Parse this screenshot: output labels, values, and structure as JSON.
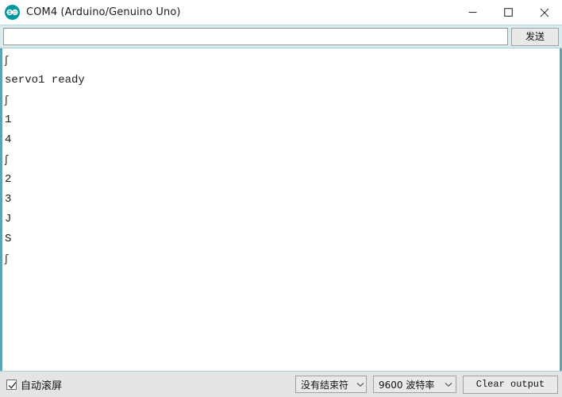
{
  "window": {
    "title": "COM4 (Arduino/Genuino Uno)",
    "logo_icon": "arduino-infinity-logo",
    "controls": [
      {
        "name": "minimize",
        "icon": "minimize-icon"
      },
      {
        "name": "maximize",
        "icon": "maximize-icon"
      },
      {
        "name": "close",
        "icon": "close-icon"
      }
    ]
  },
  "send_bar": {
    "input_value": "",
    "input_placeholder": "",
    "send_label": "发送"
  },
  "output": {
    "lines": [
      "ʃ",
      "servo1 ready",
      "ʃ",
      "1",
      "4",
      "ʃ",
      "2",
      "3",
      "J",
      "S",
      "ʃ"
    ]
  },
  "bottom_bar": {
    "autoscroll_label": "自动滚屏",
    "autoscroll_checked": true,
    "check_icon": "checkmark-icon",
    "line_ending_value": "没有结束符",
    "baud_rate_value": "9600 波特率",
    "clear_label": "Clear output",
    "dropdown_icon": "chevron-down-icon"
  },
  "colors": {
    "accent_teal": "#5aa5b5",
    "panel_teal": "#d9ecee",
    "bottom_gray": "#e4e4e4",
    "button_face": "#e9e9e9",
    "logo_teal": "#00979c"
  }
}
